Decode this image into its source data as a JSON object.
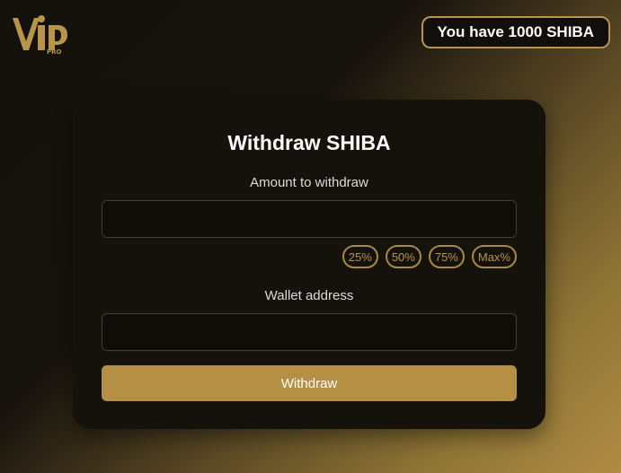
{
  "header": {
    "logo_text": "VIP",
    "logo_subtext": "PRO",
    "balance_label": "You have 1000 SHIBA"
  },
  "form": {
    "title": "Withdraw SHIBA",
    "amount_label": "Amount to withdraw",
    "amount_value": "",
    "amount_placeholder": "",
    "percent_buttons": [
      "25%",
      "50%",
      "75%",
      "Max%"
    ],
    "wallet_label": "Wallet address",
    "wallet_value": "",
    "wallet_placeholder": "",
    "submit_label": "Withdraw"
  },
  "colors": {
    "accent": "#b58f44",
    "card_background": "#15120c",
    "input_border": "#3d3f42"
  }
}
